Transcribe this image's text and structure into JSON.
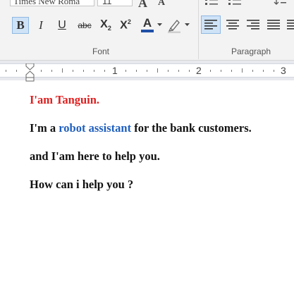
{
  "ribbon": {
    "font_name": "Times New Roma",
    "font_size": "11",
    "grow_label": "A",
    "shrink_label": "A",
    "bold_label": "B",
    "italic_label": "I",
    "underline_label": "U",
    "strike_label": "abc",
    "subscript_base": "X",
    "subscript_sub": "2",
    "superscript_base": "X",
    "superscript_sup": "2",
    "font_color_label": "A",
    "font_group_label": "Font",
    "paragraph_group_label": "Paragraph",
    "colors": {
      "font_color_bar": "#1f4fa8",
      "active": "#cfe3f7"
    }
  },
  "ruler": {
    "labels": [
      "1",
      "2",
      "3"
    ]
  },
  "document": {
    "line1": "I'am Tanguin.",
    "line2_prefix": "I'm a ",
    "line2_highlight": "robot assistant",
    "line2_suffix": " for the bank customers.",
    "line3": "and I'am here to help you.",
    "line4": "How can i help you ?",
    "colors": {
      "red": "#e02020",
      "blue": "#1f5fbf"
    }
  }
}
